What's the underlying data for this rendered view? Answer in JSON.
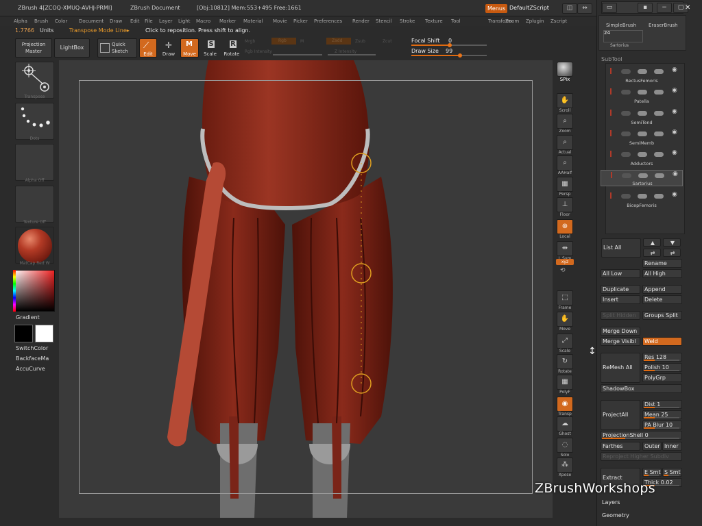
{
  "title_bar": {
    "app": "ZBrush 4[ZCOQ-XMUQ-AVHJ-PRMI]",
    "doc": "ZBrush Document",
    "stats": "[Obj:10812] Mem:553+495 Free:1661",
    "menus_btn": "Menus",
    "script": "DefaultZScript"
  },
  "menu_bar": [
    "Alpha",
    "Brush",
    "Color",
    "Document",
    "Draw",
    "Edit",
    "File",
    "Layer",
    "Light",
    "Macro",
    "Marker",
    "Material",
    "Movie",
    "Picker",
    "Preferences",
    "Render",
    "Stencil",
    "Stroke",
    "Texture",
    "Tool",
    "Transform",
    "Zoom",
    "Zplugin",
    "Zscript"
  ],
  "info_bar": {
    "units_value": "1.7766",
    "units_label": "Units",
    "mode": "Transpose Mode Line▸",
    "hint": "Click to reposition. Press shift to align."
  },
  "toolbar": {
    "projection_master": "Projection\nMaster",
    "lightbox": "LightBox",
    "quick_sketch": "Quick\nSketch",
    "edit": "Edit",
    "draw": "Draw",
    "move": "Move",
    "scale": "Scale",
    "rotate": "Rotate",
    "focal_shift_label": "Focal Shift",
    "focal_shift_value": "0",
    "draw_size_label": "Draw Size",
    "draw_size_value": "99",
    "rgb_intensity": "Rgb Intensity",
    "z_intensity": "Z Intensity",
    "mrgb": "Mrgb",
    "rgb": "Rgb",
    "m": "M",
    "zadd": "Zadd",
    "zsub": "Zsub",
    "zcut": "Zcut"
  },
  "left_shelf": {
    "transpose": "Transpose",
    "dots": "Dots",
    "alpha": "Alpha Off",
    "texture": "Texture Off",
    "material": "MatCap Red W",
    "gradient": "Gradient",
    "switch_color": "SwitchColor",
    "backface": "BackfaceMa",
    "accucurve": "AccuCurve"
  },
  "right_shelf": [
    {
      "id": "spix",
      "label": "SPix",
      "icon": "spix-icon"
    },
    {
      "id": "scroll",
      "label": "Scroll",
      "icon": "hand-icon"
    },
    {
      "id": "zoom",
      "label": "Zoom",
      "icon": "magnifier-icon"
    },
    {
      "id": "actual",
      "label": "Actual",
      "icon": "magnifier-icon"
    },
    {
      "id": "aahalf",
      "label": "AAHalf",
      "icon": "magnifier-icon"
    },
    {
      "id": "persp",
      "label": "Persp",
      "icon": "grid-icon"
    },
    {
      "id": "floor",
      "label": "Floor",
      "icon": "floor-icon"
    },
    {
      "id": "local",
      "label": "Local",
      "icon": "local-icon"
    },
    {
      "id": "lsym",
      "label": "L.Sym",
      "icon": "sym-icon"
    },
    {
      "id": "xyz",
      "label": "xyz",
      "icon": "xyz-icon"
    },
    {
      "id": "frame",
      "label": "Frame",
      "icon": "frame-icon"
    },
    {
      "id": "move",
      "label": "Move",
      "icon": "hand-icon"
    },
    {
      "id": "scale",
      "label": "Scale",
      "icon": "scale-icon"
    },
    {
      "id": "rotate",
      "label": "Rotate",
      "icon": "rotate-icon"
    },
    {
      "id": "polyf",
      "label": "PolyF",
      "icon": "polyf-icon"
    },
    {
      "id": "transp",
      "label": "Transp",
      "icon": "transp-icon"
    },
    {
      "id": "ghost",
      "label": "Ghost",
      "icon": "ghost-icon"
    },
    {
      "id": "solo",
      "label": "Solo",
      "icon": "solo-icon"
    },
    {
      "id": "xpose",
      "label": "Xpose",
      "icon": "xpose-icon"
    }
  ],
  "tool_panel": {
    "simple_brush": "SimpleBrush",
    "eraser_brush": "EraserBrush",
    "count": "24",
    "current_tool": "Sartorius"
  },
  "subtool": {
    "title": "SubTool",
    "items": [
      "RectusFemoris",
      "Patella",
      "SemiTend",
      "SemiMemb",
      "Adductors",
      "Sartorius",
      "BicepFemoris"
    ]
  },
  "subtool_buttons": {
    "list_all": "List All",
    "rename": "Rename",
    "all_low": "All Low",
    "all_high": "All High",
    "duplicate": "Duplicate",
    "append": "Append",
    "insert": "Insert",
    "delete": "Delete",
    "split_hidden": "Split Hidden",
    "groups_split": "Groups Split",
    "merge_down": "Merge Down",
    "merge_visible": "Merge Visibl",
    "weld": "Weld",
    "remesh_all": "ReMesh All",
    "res": "Res 128",
    "polish": "Polish 10",
    "polygrp": "PolyGrp",
    "shadowbox": "ShadowBox",
    "project_all": "ProjectAll",
    "dist": "Dist 1",
    "mean": "Mean 25",
    "pa_blur": "PA Blur 10",
    "projection_shell": "ProjectionShell 0",
    "farthest": "Farthes",
    "outer": "Outer",
    "inner": "Inner",
    "reproject": "Reproject Higher Subdiv",
    "extract": "Extract",
    "e_smt": "E Smt",
    "s_smt": "S Smt",
    "thick": "Thick 0.02",
    "layers": "Layers",
    "geometry": "Geometry"
  },
  "watermark": "ZBrushWorkshops",
  "colors": {
    "accent": "#d2691e",
    "muscle": "#7a2418",
    "bg": "#3a3a3a"
  }
}
